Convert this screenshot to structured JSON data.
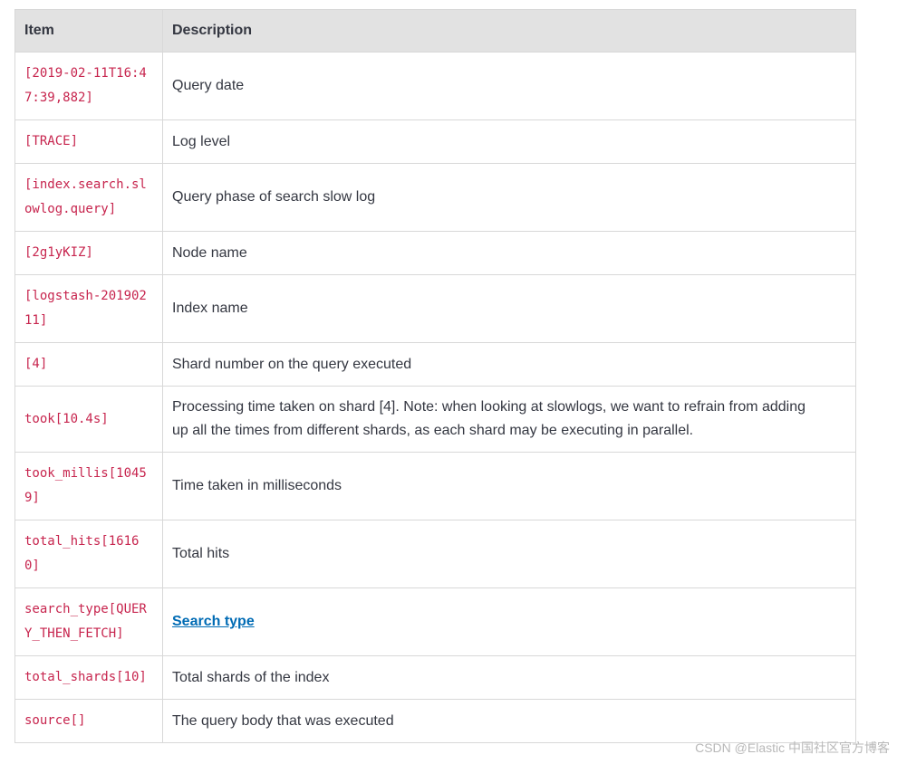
{
  "table": {
    "headers": [
      "Item",
      "Description"
    ],
    "rows": [
      {
        "item": "[2019-02-11T16:47:39,882]",
        "description": "Query date"
      },
      {
        "item": "[TRACE]",
        "description": "Log level"
      },
      {
        "item": "[index.search.slowlog.query]",
        "description": "Query phase of search slow log"
      },
      {
        "item": "[2g1yKIZ]",
        "description": "Node name"
      },
      {
        "item": "[logstash-20190211]",
        "description": "Index name"
      },
      {
        "item": "[4]",
        "description": "Shard number on the query executed"
      },
      {
        "item": "took[10.4s]",
        "description": "Processing time taken on shard [4]. Note: when looking at slowlogs, we want to refrain from adding up all the times from different shards, as each shard may be executing in parallel."
      },
      {
        "item": "took_millis[10459]",
        "description": "Time taken in milliseconds"
      },
      {
        "item": "total_hits[16160]",
        "description": "Total hits"
      },
      {
        "item": "search_type[QUERY_THEN_FETCH]",
        "description": "Search type"
      },
      {
        "item": "total_shards[10]",
        "description": "Total shards of the index"
      },
      {
        "item": "source[]",
        "description": "The query body that was executed"
      }
    ]
  },
  "watermark": "CSDN @Elastic 中国社区官方博客"
}
